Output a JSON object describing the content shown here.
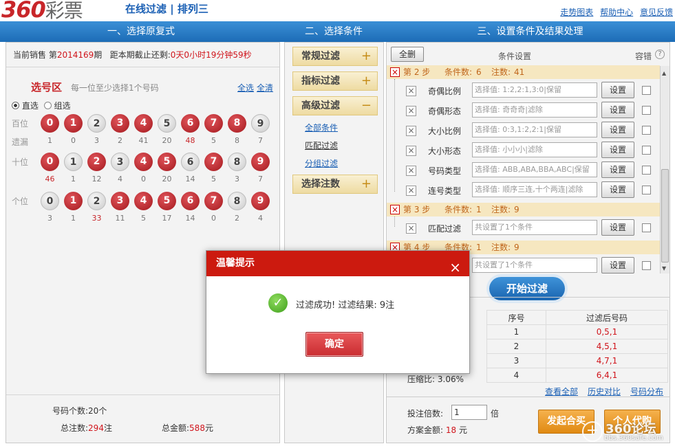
{
  "header": {
    "logo_num": "360",
    "logo_text": "彩票",
    "subtitle": "在线过滤 | 排列三",
    "links": [
      "走势图表",
      "帮助中心",
      "意见反馈"
    ]
  },
  "steps": [
    "一、选择原复式",
    "二、选择条件",
    "三、设置条件及结果处理"
  ],
  "sale": {
    "prefix": "当前销售 第",
    "period": "2014169",
    "suffix": "期",
    "deadline_label": "距本期截止还剩:",
    "deadline": "0天0小时19分钟59秒"
  },
  "pick": {
    "title": "选号区",
    "hint": "每一位至少选择1个号码",
    "select_all": "全选",
    "clear_all": "全清",
    "mode_direct": "直选",
    "mode_group": "组选",
    "miss_label": "遗漏",
    "rows": [
      {
        "label": "百位",
        "on": [
          0,
          1,
          3,
          4,
          6,
          7,
          8
        ],
        "miss": [
          "1",
          "0",
          "3",
          "2",
          "41",
          "20",
          "48",
          "5",
          "8",
          "7"
        ],
        "hot": [
          6
        ]
      },
      {
        "label": "十位",
        "on": [
          0,
          2,
          4,
          5,
          7,
          9
        ],
        "miss": [
          "46",
          "1",
          "12",
          "4",
          "0",
          "20",
          "14",
          "5",
          "3",
          "7"
        ],
        "hot": [
          0
        ]
      },
      {
        "label": "个位",
        "on": [
          1,
          3,
          4,
          5,
          6,
          7,
          9
        ],
        "miss": [
          "3",
          "1",
          "33",
          "11",
          "5",
          "17",
          "14",
          "0",
          "2",
          "4"
        ],
        "hot": [
          2
        ]
      }
    ]
  },
  "summary": {
    "count_label": "号码个数:",
    "count": "20个",
    "notes_label": "总注数:",
    "notes": "294",
    "notes_unit": "注",
    "amount_label": "总金额:",
    "amount": "588",
    "amount_unit": "元"
  },
  "filters": {
    "regular": "常规过滤",
    "index": "指标过滤",
    "advanced": "高级过滤",
    "adv_links": [
      "全部条件",
      "匹配过滤",
      "分组过滤"
    ],
    "select_notes": "选择注数"
  },
  "settings": {
    "clear_btn": "全删",
    "title": "条件设置",
    "tolerance": "容错",
    "help": "?",
    "step2": {
      "label": "第 2 步",
      "cond_label": "条件数:",
      "cond": "6",
      "notes_label": "注数:",
      "notes": "41"
    },
    "rows": [
      {
        "name": "奇偶比例",
        "value": "选择值: 1:2,2:1,3:0|保留"
      },
      {
        "name": "奇偶形态",
        "value": "选择值: 奇奇奇|滤除"
      },
      {
        "name": "大小比例",
        "value": "选择值: 0:3,1:2,2:1|保留"
      },
      {
        "name": "大小形态",
        "value": "选择值: 小小小|滤除"
      },
      {
        "name": "号码类型",
        "value": "选择值: ABB,ABA,BBA,ABC|保留"
      },
      {
        "name": "连号类型",
        "value": "选择值: 顺序三连,十个两连|滤除"
      }
    ],
    "set_btn": "设置",
    "step3": {
      "label": "第 3 步",
      "cond_label": "条件数:",
      "cond": "1",
      "notes_label": "注数:",
      "notes": "9"
    },
    "step3_row": {
      "name": "匹配过滤",
      "value": "共设置了1个条件"
    },
    "step4": {
      "label": "第 4 步",
      "cond_label": "条件数:",
      "cond": "1",
      "notes_label": "注数:",
      "notes": "9"
    },
    "step4_row": {
      "value": "共设置了1个条件"
    },
    "start_btn": "开始过滤"
  },
  "results": {
    "col_seq": "序号",
    "col_num": "过滤后号码",
    "rows": [
      [
        "1",
        "0,5,1"
      ],
      [
        "2",
        "4,5,1"
      ],
      [
        "3",
        "4,7,1"
      ],
      [
        "4",
        "6,4,1"
      ]
    ],
    "ratio_label": "压缩比:",
    "ratio": "3.06%",
    "links": [
      "查看全部",
      "历史对比",
      "号码分布"
    ],
    "mult_label": "投注倍数:",
    "mult": "1",
    "mult_unit": "倍",
    "plan_label": "方案金额:",
    "plan": "18",
    "plan_unit": "元",
    "btn_join": "发起合买",
    "btn_agent": "个人代购"
  },
  "dialog": {
    "title": "温馨提示",
    "close": "×",
    "message": "过滤成功! 过滤结果: 9注",
    "ok": "确定"
  },
  "watermark": {
    "brand": "360论坛",
    "site": "bbs.360safe.com"
  }
}
